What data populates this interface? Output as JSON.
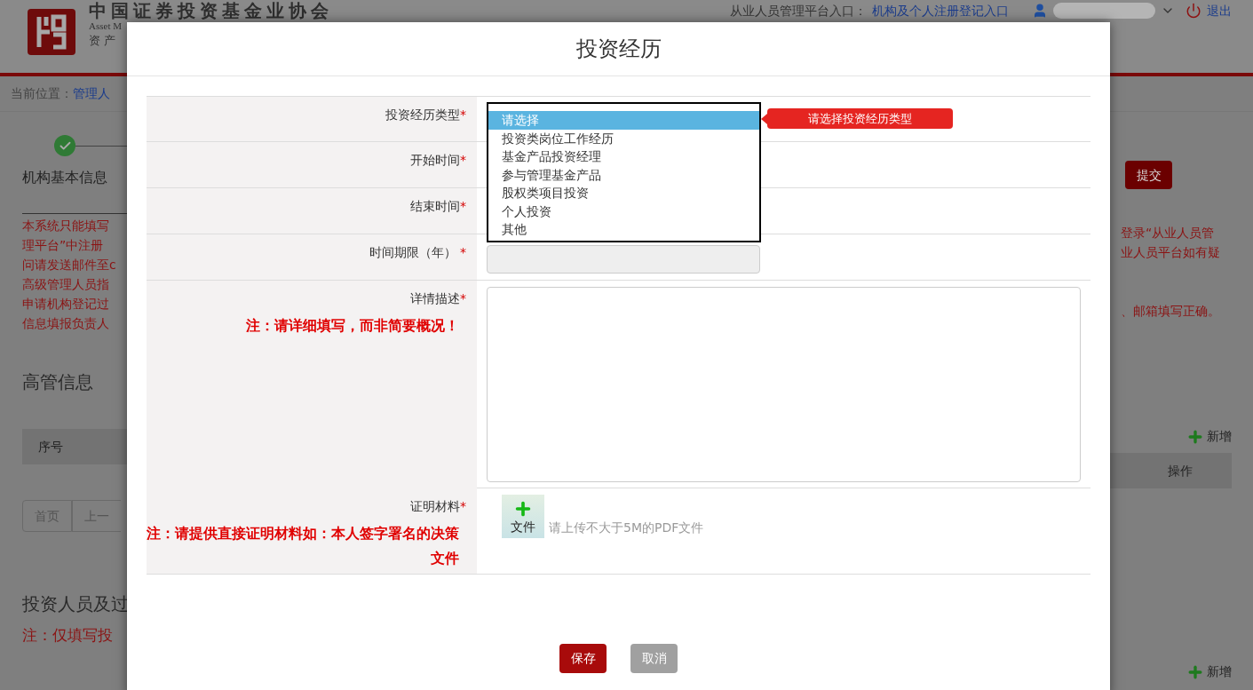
{
  "header": {
    "org_name": "中国证券投资基金业协会",
    "org_name_en": "Asset M",
    "org_name_sub": "资 产",
    "portal_label": "从业人员管理平台入口：",
    "portal_link": "机构及个人注册登记入口",
    "logout": "退出"
  },
  "breadcrumb": {
    "label": "当前位置：",
    "link": "管理人"
  },
  "steps": [
    {
      "label": "机构基本信息",
      "done": true
    }
  ],
  "notice_left": [
    "本系统只能填写",
    "理平台”中注册",
    "问请发送邮件至c",
    "高级管理人员指",
    "申请机构登记过",
    "信息填报负责人"
  ],
  "notice_right": [
    "登录“从业人员管",
    "业人员平台如有疑",
    "、邮箱填写正确。"
  ],
  "submit_button": "提交",
  "sections": [
    {
      "title": "高管信息",
      "add_label": "新增",
      "columns": [
        "序号",
        "操作"
      ],
      "pagination": [
        "首页",
        "上一"
      ]
    },
    {
      "title": "投资人员及过",
      "add_label": "新增",
      "note": "注：仅填写投"
    }
  ],
  "dialog": {
    "title": "投资经历",
    "fields": [
      {
        "kind": "select",
        "label": "投资经历类型",
        "mark": "*",
        "error": "请选择投资经历类型",
        "options": [
          {
            "label": "请选择",
            "selected": true
          },
          {
            "label": "投资类岗位工作经历",
            "selected": false
          },
          {
            "label": "基金产品投资经理",
            "selected": false
          },
          {
            "label": "参与管理基金产品",
            "selected": false
          },
          {
            "label": "股权类项目投资",
            "selected": false
          },
          {
            "label": "个人投资",
            "selected": false
          },
          {
            "label": "其他",
            "selected": false
          }
        ]
      },
      {
        "kind": "date",
        "label": "开始时间",
        "mark": "*"
      },
      {
        "kind": "date",
        "label": "结束时间",
        "mark": "*"
      },
      {
        "kind": "readonly",
        "label": "时间期限（年）",
        "mark": "*"
      },
      {
        "kind": "textarea",
        "label": "详情描述",
        "mark": "*",
        "note": "注：请详细填写，而非简要概况！"
      },
      {
        "kind": "file",
        "label": "证明材料",
        "mark": "*",
        "note": "注：请提供直接证明材料如：本人签字署名的决策文件",
        "button": "文件",
        "hint": "请上传不大于5M的PDF文件"
      }
    ],
    "buttons": [
      {
        "label": "保存",
        "kind": "primary"
      },
      {
        "label": "取消",
        "kind": "secondary"
      }
    ]
  }
}
